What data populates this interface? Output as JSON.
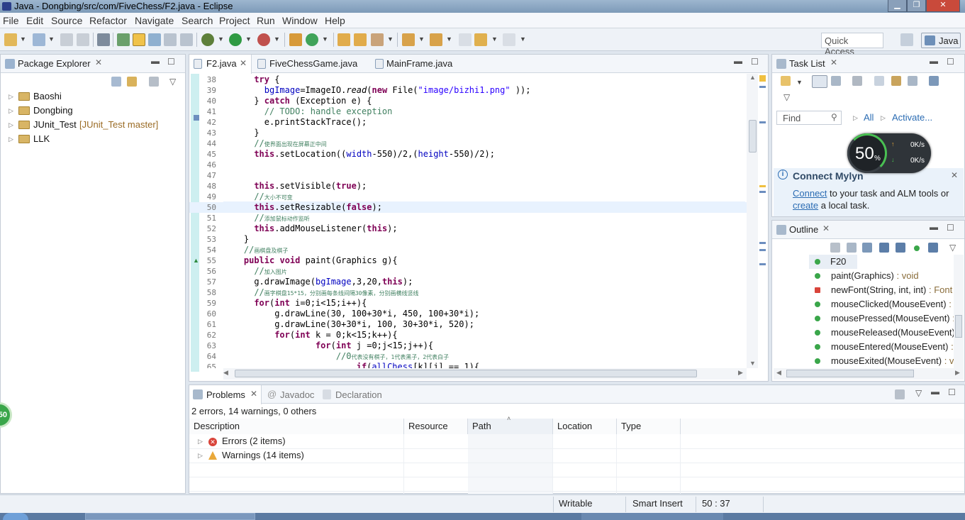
{
  "window": {
    "title": "Java - Dongbing/src/com/FiveChess/F2.java - Eclipse"
  },
  "menu": [
    "File",
    "Edit",
    "Source",
    "Refactor",
    "Navigate",
    "Search",
    "Project",
    "Run",
    "Window",
    "Help"
  ],
  "toolbar": {
    "quick_access": "Quick Access",
    "perspective": "Java"
  },
  "package_explorer": {
    "title": "Package Explorer",
    "items": [
      {
        "label": "Baoshi",
        "extra": ""
      },
      {
        "label": "Dongbing",
        "extra": ""
      },
      {
        "label": "JUnit_Test",
        "extra": "[JUnit_Test master]"
      },
      {
        "label": "LLK",
        "extra": ""
      }
    ]
  },
  "editor": {
    "tabs": [
      "F2.java",
      "FiveChessGame.java",
      "MainFrame.java"
    ],
    "lines": [
      {
        "n": "38",
        "indent": 6,
        "html": "<span class='kw'>try</span> {"
      },
      {
        "n": "39",
        "indent": 8,
        "html": "<span class='fld'>bgImage</span>=ImageIO.<i>read</i>(<span class='kw'>new</span> File(<span class='str'>\"image/bizhi1.png\"</span> ));"
      },
      {
        "n": "40",
        "indent": 6,
        "html": "} <span class='kw'>catch</span> (Exception e) {"
      },
      {
        "n": "41",
        "indent": 8,
        "html": "<span class='cmt'>// TODO: handle exception</span>"
      },
      {
        "n": "42",
        "indent": 8,
        "html": "e.printStackTrace();"
      },
      {
        "n": "43",
        "indent": 6,
        "html": "}"
      },
      {
        "n": "44",
        "indent": 6,
        "html": "<span class='cmt'>//<span class='cn'>使界面出现在屏幕正中间</span></span>"
      },
      {
        "n": "45",
        "indent": 6,
        "html": "<span class='kw'>this</span>.setLocation((<span class='fld'>width</span>-550)/2,(<span class='fld'>height</span>-550)/2);"
      },
      {
        "n": "46",
        "indent": 0,
        "html": ""
      },
      {
        "n": "47",
        "indent": 0,
        "html": ""
      },
      {
        "n": "48",
        "indent": 6,
        "html": "<span class='kw'>this</span>.setVisible(<span class='kw'>true</span>);"
      },
      {
        "n": "49",
        "indent": 6,
        "html": "<span class='cmt'>//<span class='cn'>大小不可变</span></span>"
      },
      {
        "n": "50",
        "indent": 6,
        "html": "<span class='kw'>this</span>.setResizable(<span class='kw'>false</span>);"
      },
      {
        "n": "51",
        "indent": 6,
        "html": "<span class='cmt'>//<span class='cn'>添加鼠标动作监听</span></span>"
      },
      {
        "n": "52",
        "indent": 6,
        "html": "<span class='kw'>this</span>.addMouseListener(<span class='kw'>this</span>);"
      },
      {
        "n": "53",
        "indent": 4,
        "html": "}"
      },
      {
        "n": "54",
        "indent": 4,
        "html": "<span class='cmt'>//<span class='cn'>画棋盘及棋子</span></span>"
      },
      {
        "n": "55",
        "indent": 4,
        "html": "<span class='kw'>public</span> <span class='kw'>void</span> paint(Graphics g){"
      },
      {
        "n": "56",
        "indent": 6,
        "html": "<span class='cmt'>//<span class='cn'>加入图片</span></span>"
      },
      {
        "n": "57",
        "indent": 6,
        "html": "g.drawImage(<span class='fld'>bgImage</span>,3,20,<span class='kw'>this</span>);"
      },
      {
        "n": "58",
        "indent": 6,
        "html": "<span class='cmt'>//<span class='cn'>画字棋盘15*15，分别画每条线间隔30像素，分别画横线竖线</span></span>"
      },
      {
        "n": "59",
        "indent": 6,
        "html": "<span class='kw'>for</span>(<span class='kw'>int</span> i=0;i&lt;15;i++){"
      },
      {
        "n": "60",
        "indent": 10,
        "html": "g.drawLine(30, 100+30*i, 450, 100+30*i);"
      },
      {
        "n": "61",
        "indent": 10,
        "html": "g.drawLine(30+30*i, 100, 30+30*i, 520);"
      },
      {
        "n": "62",
        "indent": 10,
        "html": "<span class='kw'>for</span>(<span class='kw'>int</span> k = 0;k&lt;15;k++){"
      },
      {
        "n": "63",
        "indent": 18,
        "html": "<span class='kw'>for</span>(<span class='kw'>int</span> j =0;j&lt;15;j++){"
      },
      {
        "n": "64",
        "indent": 22,
        "html": "<span class='cmt'>//0<span class='cn'>代表没有棋子，1代表黑子，2代表白子</span></span>"
      },
      {
        "n": "65",
        "indent": 26,
        "html": "<span class='kw'>if</span>(<span class='fld'>allChess</span>[k][j] == 1){"
      }
    ]
  },
  "task_list": {
    "title": "Task List",
    "find_placeholder": "Find",
    "all": "All",
    "activate": "Activate...",
    "mylyn_title": "Connect Mylyn",
    "mylyn_connect": "Connect",
    "mylyn_text1": " to your task and ALM tools or",
    "mylyn_create": "create",
    "mylyn_text2": " a local task."
  },
  "net_widget": {
    "percent": "50",
    "unit": "%",
    "up": "0K/s",
    "down": "0K/s"
  },
  "side_badge": "50",
  "outline": {
    "title": "Outline",
    "items": [
      {
        "label": "F20",
        "type": ""
      },
      {
        "label": "paint(Graphics)",
        "type": " : void"
      },
      {
        "label": "newFont(String, int, int)",
        "type": " : Font"
      },
      {
        "label": "mouseClicked(MouseEvent)",
        "type": " :"
      },
      {
        "label": "mousePressed(MouseEvent)",
        "type": " :"
      },
      {
        "label": "mouseReleased(MouseEvent)",
        "type": ""
      },
      {
        "label": "mouseEntered(MouseEvent)",
        "type": " :"
      },
      {
        "label": "mouseExited(MouseEvent)",
        "type": " : v"
      }
    ]
  },
  "problems": {
    "tabs": [
      "Problems",
      "Javadoc",
      "Declaration"
    ],
    "summary": "2 errors, 14 warnings, 0 others",
    "columns": [
      "Description",
      "Resource",
      "Path",
      "Location",
      "Type"
    ],
    "rows": [
      {
        "label": "Errors (2 items)",
        "kind": "error"
      },
      {
        "label": "Warnings (14 items)",
        "kind": "warning"
      }
    ]
  },
  "status": {
    "writable": "Writable",
    "insert_mode": "Smart Insert",
    "position": "50 : 37"
  },
  "colors": {
    "keyword": "#7f0055",
    "string": "#2a00ff",
    "comment": "#3f7f5f",
    "field": "#0000c0",
    "accent": "#3b6ea5"
  }
}
